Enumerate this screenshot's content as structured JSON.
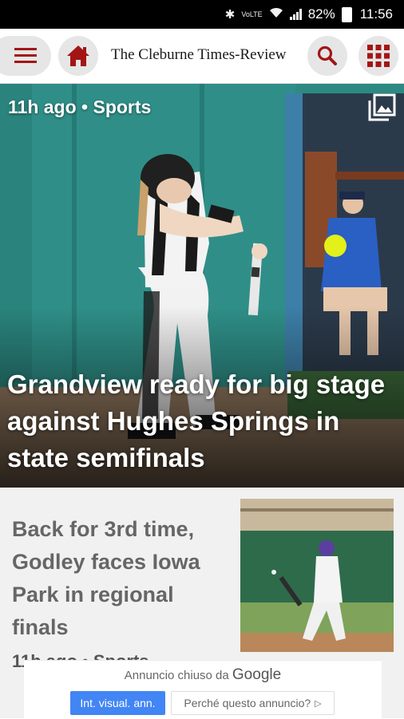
{
  "status_bar": {
    "battery": "82%",
    "time": "11:56",
    "network_label": "VoLTE"
  },
  "header": {
    "site_title": "The Cleburne Times-Review"
  },
  "icons": {
    "menu": "hamburger-menu-icon",
    "home": "home-icon",
    "search": "search-icon",
    "apps": "grid-apps-icon",
    "gallery": "photo-gallery-icon"
  },
  "colors": {
    "accent": "#a31515",
    "hero_bg": "#2d8a83",
    "card_bg": "#f1f1f1",
    "ad_button": "#4285f4"
  },
  "hero": {
    "meta": "11h ago • Sports",
    "headline": "Grandview ready for big stage against Hughes Springs in state semifinals"
  },
  "story2": {
    "headline": "Back for 3rd time, Godley faces Iowa Park in regional finals",
    "meta": "11h ago • Sports"
  },
  "ad": {
    "caption_prefix": "Annuncio chiuso da",
    "caption_brand": "Google",
    "primary_button": "Int. visual. ann.",
    "secondary_button": "Perché questo annuncio?"
  }
}
